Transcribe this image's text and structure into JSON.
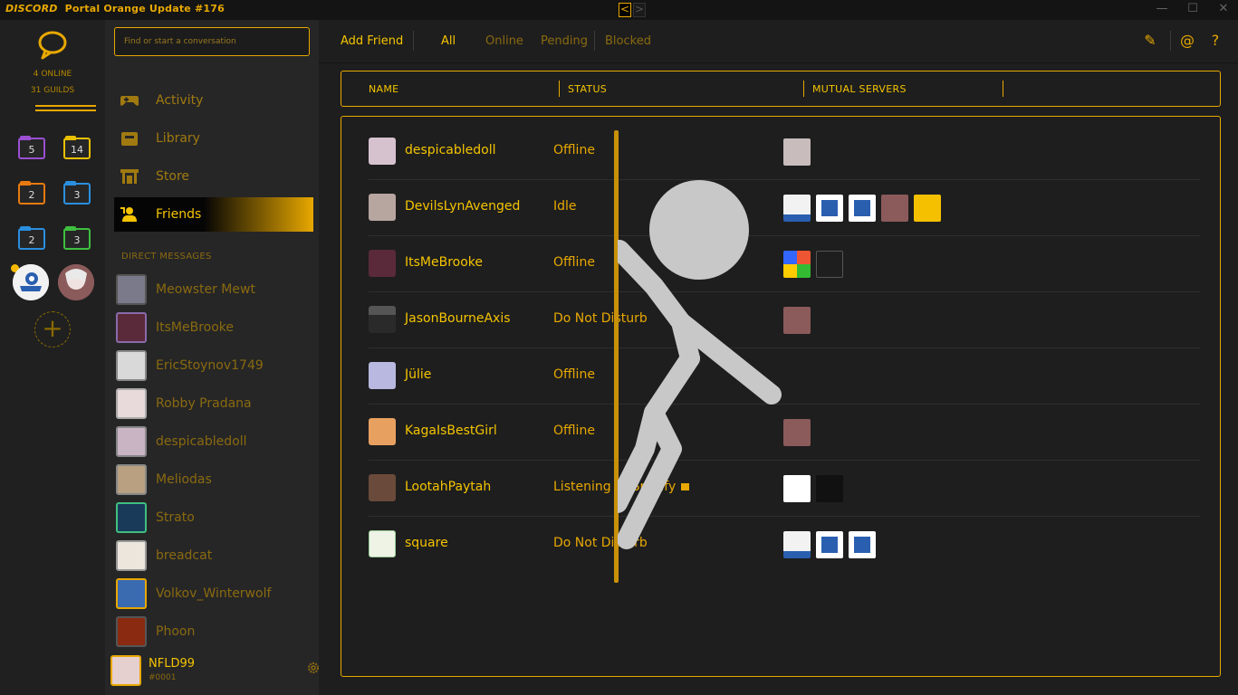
{
  "window": {
    "brand": "DISCORD",
    "title": "Portal Orange Update #176",
    "nav_back": "<",
    "nav_forward": ">",
    "minimize": "—",
    "maximize": "☐",
    "close": "✕"
  },
  "guilds": {
    "online": "4 ONLINE",
    "guild_count": "31 GUILDS",
    "folders": [
      {
        "count": "5",
        "color": "#9b4fd1"
      },
      {
        "count": "14",
        "color": "#e8c000"
      },
      {
        "count": "2",
        "color": "#e87a10"
      },
      {
        "count": "3",
        "color": "#2a8fe0"
      },
      {
        "count": "2",
        "color": "#2a8fe0"
      },
      {
        "count": "3",
        "color": "#3fbf3f"
      }
    ],
    "add_server": "+"
  },
  "sidebar": {
    "search_placeholder": "Find or start a conversation",
    "nav": [
      {
        "label": "Activity",
        "icon": "gamepad-icon"
      },
      {
        "label": "Library",
        "icon": "library-icon"
      },
      {
        "label": "Store",
        "icon": "store-icon"
      },
      {
        "label": "Friends",
        "icon": "friends-icon",
        "active": true
      }
    ],
    "dm_header": "DIRECT MESSAGES",
    "dms": [
      {
        "name": "Meowster Mewt"
      },
      {
        "name": "ItsMeBrooke"
      },
      {
        "name": "EricStoynov1749"
      },
      {
        "name": "Robby Pradana"
      },
      {
        "name": "despicabledoll"
      },
      {
        "name": "Meliodas"
      },
      {
        "name": "Strato"
      },
      {
        "name": "breadcat"
      },
      {
        "name": "Volkov_Winterwolf"
      },
      {
        "name": "Phoon"
      }
    ],
    "user": {
      "name": "NFLD99",
      "tag": "#0001"
    }
  },
  "topbar": {
    "add_friend": "Add Friend",
    "tabs": [
      "All",
      "Online",
      "Pending",
      "Blocked"
    ],
    "active_tab": "All",
    "icons": {
      "new_dm": "✎",
      "mentions": "@",
      "help": "?"
    }
  },
  "table": {
    "columns": [
      "NAME",
      "STATUS",
      "MUTUAL SERVERS"
    ],
    "rows": [
      {
        "name": "despicabledoll",
        "status": "Offline",
        "mutuals": 1
      },
      {
        "name": "DevilsLynAvenged",
        "status": "Idle",
        "mutuals": 5
      },
      {
        "name": "ItsMeBrooke",
        "status": "Offline",
        "mutuals": 2
      },
      {
        "name": "JasonBourneAxis",
        "status": "Do Not Disturb",
        "mutuals": 1
      },
      {
        "name": "Jülie",
        "status": "Offline",
        "mutuals": 0
      },
      {
        "name": "KagaIsBestGirl",
        "status": "Offline",
        "mutuals": 1
      },
      {
        "name": "LootahPaytah",
        "status": "Listening to Spotify",
        "mutuals": 2
      },
      {
        "name": "square",
        "status": "Do Not Disturb",
        "mutuals": 3
      }
    ]
  },
  "colors": {
    "accent": "#e8a800",
    "accent_bright": "#f5c400",
    "bg_dark": "#1e1e1e"
  }
}
